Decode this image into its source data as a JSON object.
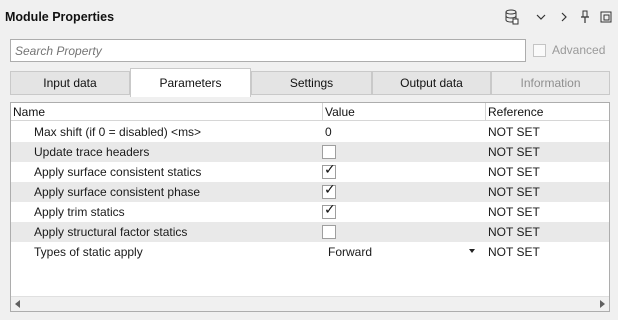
{
  "panel": {
    "title": "Module Properties",
    "icons": [
      "database-save-icon",
      "chevron-down-icon",
      "chevron-right-icon",
      "pin-icon",
      "float-window-icon"
    ]
  },
  "search": {
    "placeholder": "Search Property"
  },
  "advanced": {
    "label": "Advanced",
    "checked": false
  },
  "tabs": [
    {
      "label": "Input data"
    },
    {
      "label": "Parameters"
    },
    {
      "label": "Settings"
    },
    {
      "label": "Output data"
    },
    {
      "label": "Information"
    }
  ],
  "active_tab": "Parameters",
  "disabled_tab": "Information",
  "grid": {
    "columns": [
      "Name",
      "Value",
      "Reference"
    ],
    "rows": [
      {
        "name": "Max shift (if 0 = disabled) <ms>",
        "value": "0",
        "reference": "NOT SET"
      },
      {
        "name": "Update trace headers",
        "checked": false,
        "reference": "NOT SET"
      },
      {
        "name": "Apply surface consistent statics",
        "checked": true,
        "reference": "NOT SET"
      },
      {
        "name": "Apply surface consistent phase",
        "checked": true,
        "reference": "NOT SET"
      },
      {
        "name": "Apply trim statics",
        "checked": true,
        "reference": "NOT SET"
      },
      {
        "name": "Apply structural factor statics",
        "checked": false,
        "reference": "NOT SET"
      },
      {
        "name": "Types of static apply",
        "value": "Forward",
        "reference": "NOT SET"
      }
    ]
  }
}
